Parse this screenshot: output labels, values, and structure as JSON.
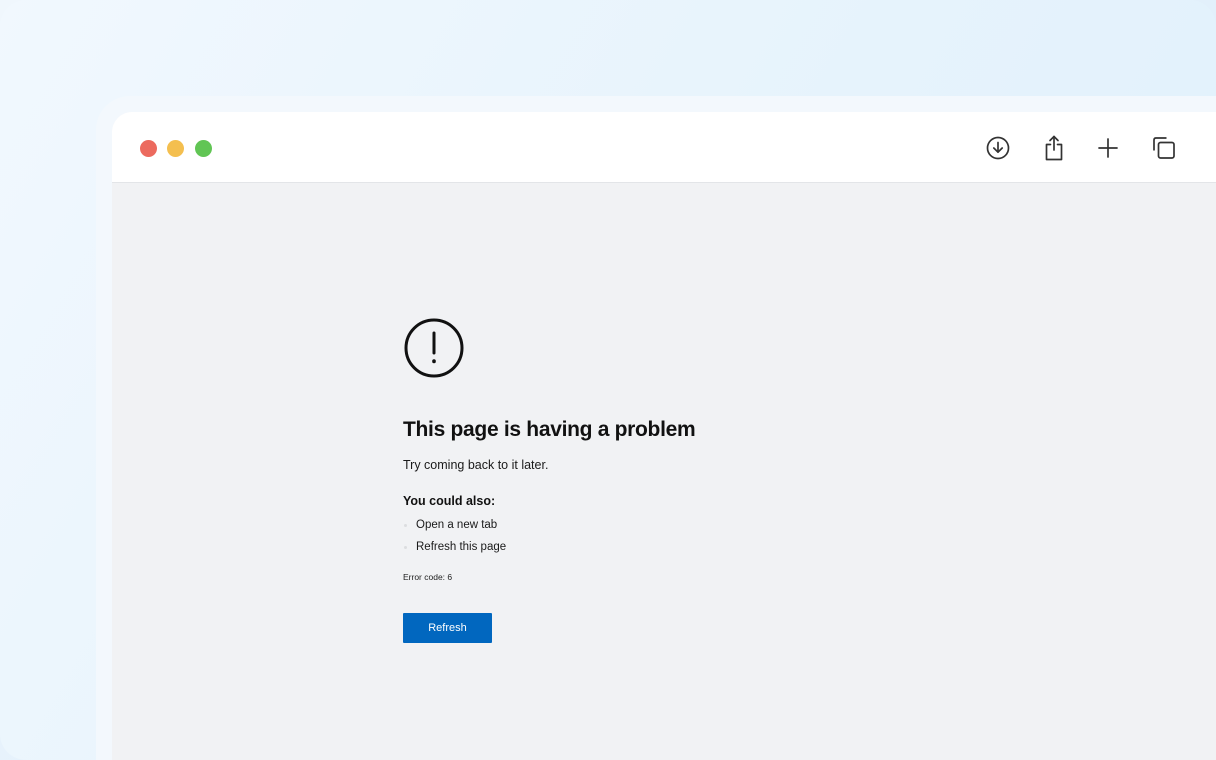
{
  "error_page": {
    "title": "This page is having a problem",
    "subtitle": "Try coming back to it later.",
    "also_heading": "You could also:",
    "suggestions": [
      "Open a new tab",
      "Refresh this page"
    ],
    "error_code": "Error code: 6",
    "refresh_label": "Refresh",
    "accent_color": "#0167bf"
  },
  "toolbar": {
    "icons": [
      "download-icon",
      "share-icon",
      "new-tab-icon",
      "tabs-overview-icon"
    ]
  },
  "traffic_lights": {
    "close": "#ec6a5e",
    "minimize": "#f4bf4f",
    "maximize": "#61c554"
  }
}
